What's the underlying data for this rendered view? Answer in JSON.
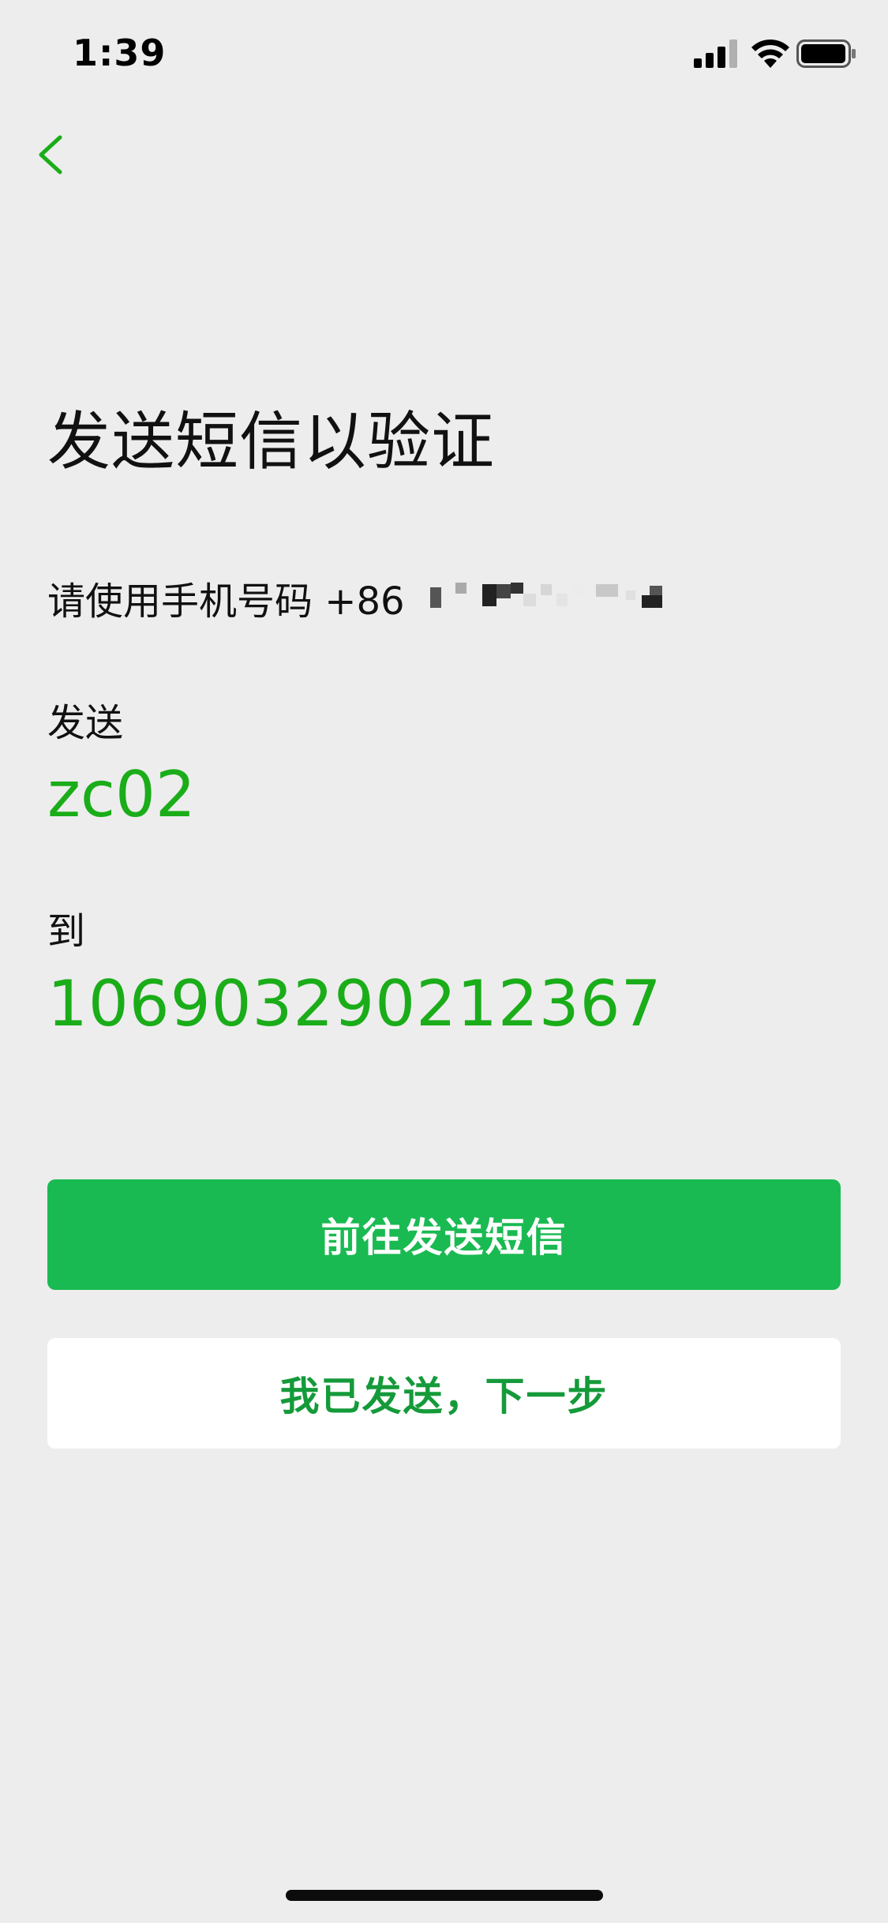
{
  "status_bar": {
    "time": "1:39",
    "icons": [
      "signal-icon",
      "wifi-icon",
      "battery-icon"
    ]
  },
  "nav": {
    "back_icon": "chevron-left-icon"
  },
  "title": "发送短信以验证",
  "instruction": {
    "prefix": "请使用手机号码 +86"
  },
  "send": {
    "label": "发送",
    "content": "zc02"
  },
  "to": {
    "label": "到",
    "number": "106903290212367"
  },
  "buttons": {
    "primary": "前往发送短信",
    "secondary": "我已发送，下一步"
  },
  "colors": {
    "background": "#ededed",
    "accent_green": "#1aad19",
    "primary_button": "#1aba52",
    "secondary_button_text": "#159a3a"
  }
}
